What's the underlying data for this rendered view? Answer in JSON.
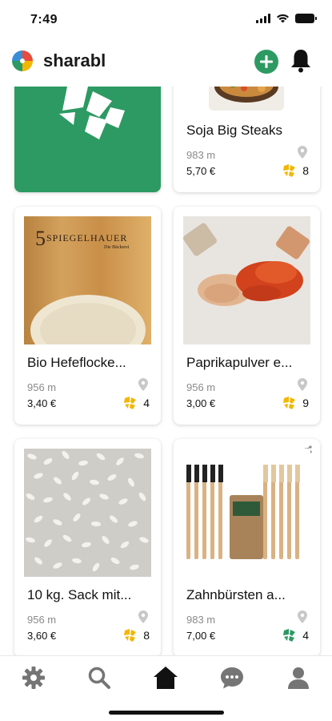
{
  "status_bar": {
    "time": "7:49"
  },
  "header": {
    "brand_name": "sharabl"
  },
  "colors": {
    "accent": "#2d9a63",
    "rating_yellow": "#f2b705",
    "rating_green": "#2d9a63"
  },
  "products": [
    {
      "title": "",
      "image": "sharabl-logo-banner"
    },
    {
      "title": "Soja Big Steaks",
      "distance": "983 m",
      "price": "5,70 €",
      "rating": "8",
      "rating_color": "yellow"
    },
    {
      "title": "Bio Hefeflocke...",
      "distance": "956 m",
      "price": "3,40 €",
      "rating": "4",
      "rating_color": "yellow",
      "image_text": "SPIEGELHAUER",
      "image_subtext": "Die Bäckerei"
    },
    {
      "title": "Paprikapulver e...",
      "distance": "956 m",
      "price": "3,00 €",
      "rating": "9",
      "rating_color": "yellow"
    },
    {
      "title": "10 kg. Sack mit...",
      "distance": "956 m",
      "price": "3,60 €",
      "rating": "8",
      "rating_color": "yellow"
    },
    {
      "title": "Zahnbürsten a...",
      "distance": "983 m",
      "price": "7,00 €",
      "rating": "4",
      "rating_color": "green"
    }
  ],
  "nav": [
    {
      "icon": "gear-icon"
    },
    {
      "icon": "search-icon"
    },
    {
      "icon": "home-icon",
      "active": true
    },
    {
      "icon": "chat-icon"
    },
    {
      "icon": "profile-icon"
    }
  ]
}
